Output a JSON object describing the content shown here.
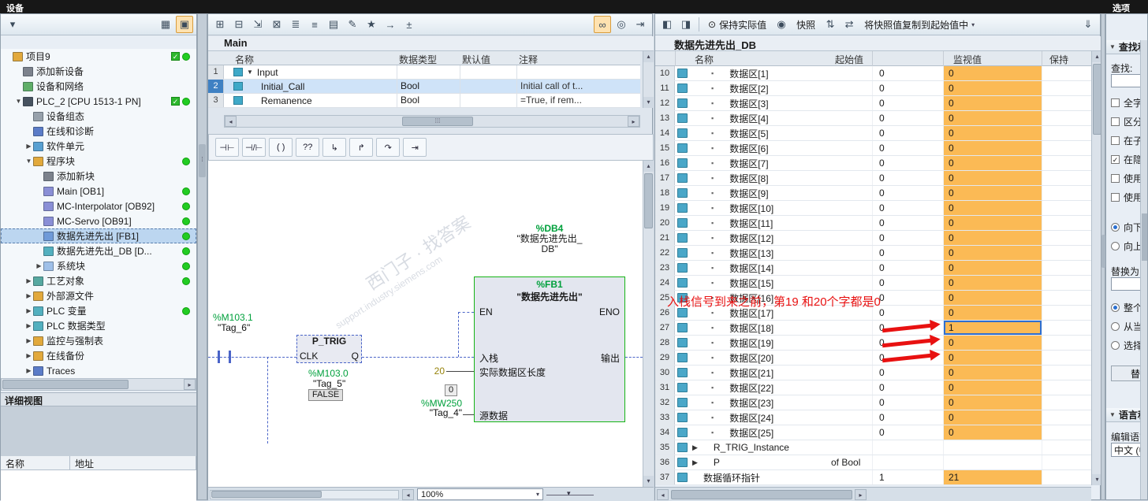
{
  "app": {
    "devices_header": "设备",
    "options_header": "选项"
  },
  "tree": {
    "items": [
      {
        "label": "项目9",
        "cls": "lvl0",
        "ic": "#e2a93c",
        "check": true,
        "dot": true
      },
      {
        "label": "添加新设备",
        "cls": "lvl1",
        "ic": "#7c828c"
      },
      {
        "label": "设备和网络",
        "cls": "lvl1",
        "ic": "#5fae68"
      },
      {
        "label": "PLC_2 [CPU 1513-1 PN]",
        "cls": "lvl1",
        "ic": "#46525f",
        "exp": "▼",
        "check": true,
        "dot": true
      },
      {
        "label": "设备组态",
        "cls": "lvl2",
        "ic": "#97a1ab"
      },
      {
        "label": "在线和诊断",
        "cls": "lvl2",
        "ic": "#5b7cc8"
      },
      {
        "label": "软件单元",
        "cls": "lvl2",
        "ic": "#58a0d2",
        "exp": "▶"
      },
      {
        "label": "程序块",
        "cls": "lvl2",
        "ic": "#e2a93c",
        "exp": "▼",
        "dot": true
      },
      {
        "label": "添加新块",
        "cls": "lvl3",
        "ic": "#7c828c"
      },
      {
        "label": "Main [OB1]",
        "cls": "lvl3",
        "ic": "#8a8fd6",
        "dot": true
      },
      {
        "label": "MC-Interpolator [OB92]",
        "cls": "lvl3",
        "ic": "#8a8fd6",
        "dot": true
      },
      {
        "label": "MC-Servo [OB91]",
        "cls": "lvl3",
        "ic": "#8a8fd6",
        "dot": true
      },
      {
        "label": "数据先进先出 [FB1]",
        "cls": "lvl3 sel",
        "ic": "#6f9ad8",
        "dot": true
      },
      {
        "label": "数据先进先出_DB [D...",
        "cls": "lvl3",
        "ic": "#53b0bf",
        "dot": true
      },
      {
        "label": "系统块",
        "cls": "lvl3",
        "ic": "#9fc0e8",
        "exp": "▶",
        "dot": true
      },
      {
        "label": "工艺对象",
        "cls": "lvl2",
        "ic": "#56a8a0",
        "exp": "▶",
        "dot": true
      },
      {
        "label": "外部源文件",
        "cls": "lvl2",
        "ic": "#e2a93c",
        "exp": "▶"
      },
      {
        "label": "PLC 变量",
        "cls": "lvl2",
        "ic": "#53b0bf",
        "exp": "▶",
        "dot": true
      },
      {
        "label": "PLC 数据类型",
        "cls": "lvl2",
        "ic": "#53b0bf",
        "exp": "▶"
      },
      {
        "label": "监控与强制表",
        "cls": "lvl2",
        "ic": "#e2a93c",
        "exp": "▶"
      },
      {
        "label": "在线备份",
        "cls": "lvl2",
        "ic": "#e2a93c",
        "exp": "▶"
      },
      {
        "label": "Traces",
        "cls": "lvl2",
        "ic": "#5b7cc8",
        "exp": "▶"
      }
    ]
  },
  "details": {
    "title": "详细视图",
    "name_col": "名称",
    "addr_col": "地址"
  },
  "editor": {
    "title": "Main",
    "iface": {
      "col_name": "名称",
      "col_type": "数据类型",
      "col_def": "默认值",
      "col_cmt": "注释",
      "rows": [
        {
          "num": "1",
          "exp": "▼",
          "name": "Input",
          "type": "",
          "def": "",
          "cmt": ""
        },
        {
          "num": "2",
          "name": "Initial_Call",
          "type": "Bool",
          "def": "",
          "cmt": "Initial call of t...",
          "cls": "sel ind"
        },
        {
          "num": "3",
          "name": "Remanence",
          "type": "Bool",
          "def": "",
          "cmt": "=True, if rem...",
          "cls": "ind"
        }
      ]
    },
    "tools": [
      {
        "n": "insert-network-icon",
        "g": "⊞"
      },
      {
        "n": "delete-network-icon",
        "g": "⊟"
      },
      {
        "n": "insert-row-icon",
        "g": "⇲"
      },
      {
        "n": "delete-row-icon",
        "g": "⊠"
      },
      {
        "n": "expand-all-networks-icon",
        "g": "≣"
      },
      {
        "n": "collapse-all-networks-icon",
        "g": "≡"
      },
      {
        "n": "absolute-symbolic-operands-icon",
        "g": "▤"
      },
      {
        "n": "network-comment-icon",
        "g": "✎"
      },
      {
        "n": "favorites-icon",
        "g": "★"
      },
      {
        "n": "goto-network-icon",
        "g": "→"
      },
      {
        "n": "snapshot-values-icon",
        "g": "±"
      }
    ],
    "tools_right": [
      {
        "n": "monitoring-on-icon",
        "g": "∞",
        "cls": "act"
      },
      {
        "n": "call-environment-icon",
        "g": "◎"
      },
      {
        "n": "split-editor-icon",
        "g": "⇥"
      }
    ],
    "ladtools": [
      {
        "n": "open-contact-button",
        "g": "⊣⊢"
      },
      {
        "n": "closed-contact-button",
        "g": "⊣/⊢"
      },
      {
        "n": "coil-button",
        "g": "( )"
      },
      {
        "n": "empty-box-button",
        "g": "??"
      },
      {
        "n": "open-branch-button",
        "g": "↳"
      },
      {
        "n": "close-branch-button",
        "g": "↱"
      },
      {
        "n": "jump-button",
        "g": "↷"
      },
      {
        "n": "insert-element-button",
        "g": "⇥"
      }
    ],
    "net": {
      "db_addr": "%DB4",
      "db_name_1": "\"数据先进先出_",
      "db_name_2": "DB\"",
      "fb_addr": "%FB1",
      "fb_name": "\"数据先进先出\"",
      "en": "EN",
      "eno": "ENO",
      "pin_push": "入栈",
      "pin_len": "实际数据区长度",
      "pin_src": "源数据",
      "pin_out": "输出",
      "contact_addr": "%M103.1",
      "contact_tag": "\"Tag_6\"",
      "trig": "P_TRIG",
      "clk": "CLK",
      "q": "Q",
      "flag_addr": "%M103.0",
      "flag_tag": "\"Tag_5\"",
      "flag_val": "FALSE",
      "len_val": "20",
      "src_val": "0",
      "src_addr": "%MW250",
      "src_tag": "\"Tag_4\""
    },
    "zoom": "100%",
    "watermark_cn": "西门子 · 找答案",
    "watermark_url": "support.industry.siemens.com"
  },
  "db": {
    "title": "数据先进先出_DB",
    "toolbar": {
      "keep": "保持实际值",
      "snapshot": "快照",
      "copy": "将快照值复制到起始值中"
    },
    "cols": {
      "name": "名称",
      "start": "起始值",
      "monitor": "监视值",
      "retain": "保持"
    },
    "annotation": "入栈信号到来之前，第19 和20个字都是0",
    "rows": [
      {
        "num": "10",
        "name": "数据区[1]",
        "start": "0",
        "mon": "0",
        "mcls": "on",
        "icon": true,
        "bullet": true
      },
      {
        "num": "11",
        "name": "数据区[2]",
        "start": "0",
        "mon": "0",
        "mcls": "on",
        "icon": true,
        "bullet": true
      },
      {
        "num": "12",
        "name": "数据区[3]",
        "start": "0",
        "mon": "0",
        "mcls": "on",
        "icon": true,
        "bullet": true
      },
      {
        "num": "13",
        "name": "数据区[4]",
        "start": "0",
        "mon": "0",
        "mcls": "on",
        "icon": true,
        "bullet": true
      },
      {
        "num": "14",
        "name": "数据区[5]",
        "start": "0",
        "mon": "0",
        "mcls": "on",
        "icon": true,
        "bullet": true
      },
      {
        "num": "15",
        "name": "数据区[6]",
        "start": "0",
        "mon": "0",
        "mcls": "on",
        "icon": true,
        "bullet": true
      },
      {
        "num": "16",
        "name": "数据区[7]",
        "start": "0",
        "mon": "0",
        "mcls": "on",
        "icon": true,
        "bullet": true
      },
      {
        "num": "17",
        "name": "数据区[8]",
        "start": "0",
        "mon": "0",
        "mcls": "on",
        "icon": true,
        "bullet": true
      },
      {
        "num": "18",
        "name": "数据区[9]",
        "start": "0",
        "mon": "0",
        "mcls": "on",
        "icon": true,
        "bullet": true
      },
      {
        "num": "19",
        "name": "数据区[10]",
        "start": "0",
        "mon": "0",
        "mcls": "on",
        "icon": true,
        "bullet": true
      },
      {
        "num": "20",
        "name": "数据区[11]",
        "start": "0",
        "mon": "0",
        "mcls": "on",
        "icon": true,
        "bullet": true
      },
      {
        "num": "21",
        "name": "数据区[12]",
        "start": "0",
        "mon": "0",
        "mcls": "on",
        "icon": true,
        "bullet": true
      },
      {
        "num": "22",
        "name": "数据区[13]",
        "start": "0",
        "mon": "0",
        "mcls": "on",
        "icon": true,
        "bullet": true
      },
      {
        "num": "23",
        "name": "数据区[14]",
        "start": "0",
        "mon": "0",
        "mcls": "on",
        "icon": true,
        "bullet": true
      },
      {
        "num": "24",
        "name": "数据区[15]",
        "start": "0",
        "mon": "0",
        "mcls": "on",
        "icon": true,
        "bullet": true
      },
      {
        "num": "25",
        "name": "数据区[16]",
        "start": "0",
        "mon": "0",
        "mcls": "on",
        "icon": true,
        "bullet": true
      },
      {
        "num": "26",
        "name": "数据区[17]",
        "start": "0",
        "mon": "0",
        "mcls": "on",
        "icon": true,
        "bullet": true
      },
      {
        "num": "27",
        "name": "数据区[18]",
        "start": "0",
        "mon": "1",
        "mcls": "sel",
        "icon": true,
        "bullet": true
      },
      {
        "num": "28",
        "name": "数据区[19]",
        "start": "0",
        "mon": "0",
        "mcls": "on",
        "icon": true,
        "bullet": true
      },
      {
        "num": "29",
        "name": "数据区[20]",
        "start": "0",
        "mon": "0",
        "mcls": "on",
        "icon": true,
        "bullet": true
      },
      {
        "num": "30",
        "name": "数据区[21]",
        "start": "0",
        "mon": "0",
        "mcls": "on",
        "icon": true,
        "bullet": true
      },
      {
        "num": "31",
        "name": "数据区[22]",
        "start": "0",
        "mon": "0",
        "mcls": "on",
        "icon": true,
        "bullet": true
      },
      {
        "num": "32",
        "name": "数据区[23]",
        "start": "0",
        "mon": "0",
        "mcls": "on",
        "icon": true,
        "bullet": true
      },
      {
        "num": "33",
        "name": "数据区[24]",
        "start": "0",
        "mon": "0",
        "mcls": "on",
        "icon": true,
        "bullet": true
      },
      {
        "num": "34",
        "name": "数据区[25]",
        "start": "0",
        "mon": "0",
        "mcls": "on",
        "icon": true,
        "bullet": true
      },
      {
        "num": "35",
        "name": "R_TRIG_Instance",
        "tri": "▶",
        "start": "",
        "mon": "",
        "mcls": "off",
        "icon": true
      },
      {
        "num": "36",
        "name": "P",
        "tri": "▶",
        "type": "of Bool",
        "start": "",
        "mon": "",
        "mcls": "off",
        "icon": true
      },
      {
        "num": "37",
        "name": "数据循环指针",
        "start": "1",
        "mon": "21",
        "mcls": "on",
        "icon": true
      }
    ]
  },
  "options": {
    "find_section": "查找和替换",
    "find_label": "查找:",
    "checks": [
      {
        "label": "全字匹配",
        "state": ""
      },
      {
        "label": "区分大小写",
        "state": ""
      },
      {
        "label": "在子结构中查找",
        "state": ""
      },
      {
        "label": "在隐藏文本中查找",
        "state": "chk"
      },
      {
        "label": "使用通配符",
        "state": ""
      },
      {
        "label": "使用正则表达式",
        "state": ""
      }
    ],
    "dir_radios": [
      {
        "label": "向下",
        "state": "sel"
      },
      {
        "label": "向上",
        "state": ""
      }
    ],
    "replace_label": "替换为:",
    "scope_radios": [
      {
        "label": "整个文档",
        "state": "sel"
      },
      {
        "label": "从当前位置开始",
        "state": ""
      },
      {
        "label": "选择",
        "state": ""
      }
    ],
    "replace_button": "替换",
    "lang_section": "语言和资源",
    "edit_lang_label": "编辑语言:",
    "edit_lang_value": "中文 (中华人民共和国)"
  }
}
